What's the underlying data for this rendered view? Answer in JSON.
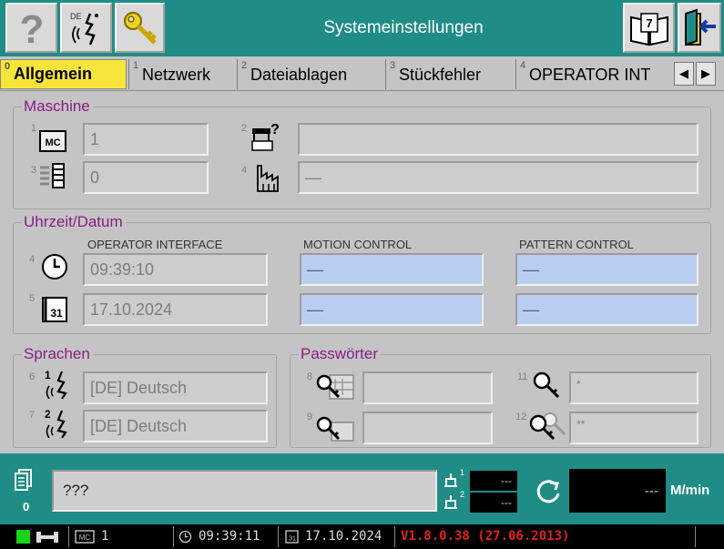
{
  "window": {
    "title": "Systemeinstellungen"
  },
  "toolbar": {
    "help_icon": "question-mark",
    "lang_flag_text": "DE",
    "book_number": "7"
  },
  "tabs": [
    {
      "num": "0",
      "label": "Allgemein"
    },
    {
      "num": "1",
      "label": "Netzwerk"
    },
    {
      "num": "2",
      "label": "Dateiablagen"
    },
    {
      "num": "3",
      "label": "Stückfehler"
    },
    {
      "num": "4",
      "label": "OPERATOR INT"
    }
  ],
  "tab_scroll": {
    "left": "◀",
    "right": "▶"
  },
  "maschine": {
    "title": "Maschine",
    "fields": [
      {
        "idx": "1",
        "icon": "mc-icon",
        "icon_text": "MC",
        "value": "1"
      },
      {
        "idx": "2",
        "icon": "machine-query-icon",
        "value": ""
      },
      {
        "idx": "3",
        "icon": "needle-bed-icon",
        "value": "0"
      },
      {
        "idx": "4",
        "icon": "factory-icon",
        "value": "—"
      }
    ]
  },
  "time_date": {
    "title": "Uhrzeit/Datum",
    "columns": [
      "OPERATOR INTERFACE",
      "MOTION CONTROL",
      "PATTERN CONTROL"
    ],
    "rows": [
      {
        "idx": "4",
        "icon": "clock-icon",
        "values": [
          "09:39:10",
          "—",
          "—"
        ]
      },
      {
        "idx": "5",
        "icon": "calendar-icon",
        "icon_text": "31",
        "values": [
          "17.10.2024",
          "—",
          "—"
        ]
      }
    ]
  },
  "sprachen": {
    "title": "Sprachen",
    "items": [
      {
        "idx": "6",
        "badge": "1",
        "value": "[DE] Deutsch"
      },
      {
        "idx": "7",
        "badge": "2",
        "value": "[DE] Deutsch"
      }
    ]
  },
  "passwoerter": {
    "title": "Passwörter",
    "items": [
      {
        "idx": "8",
        "value": ""
      },
      {
        "idx": "9",
        "value": ""
      },
      {
        "idx": "11",
        "value": "*"
      },
      {
        "idx": "12",
        "value": "**"
      }
    ]
  },
  "bottom": {
    "counter": "0",
    "message": "???",
    "speed_1": "---",
    "speed_2": "---",
    "speed_main": "---",
    "speed_unit": "M/min",
    "counter_badge_1": "1",
    "counter_badge_2": "2"
  },
  "status": {
    "mc_value": "1",
    "time": "09:39:11",
    "date": "17.10.2024",
    "version": "V1.8.0.38 (27.06.2013)"
  },
  "colors": {
    "accent": "#1f8c86",
    "section_title": "#8a1c86",
    "active_tab": "#f7e53a",
    "version_red": "#e02020",
    "status_green": "#19d219"
  }
}
